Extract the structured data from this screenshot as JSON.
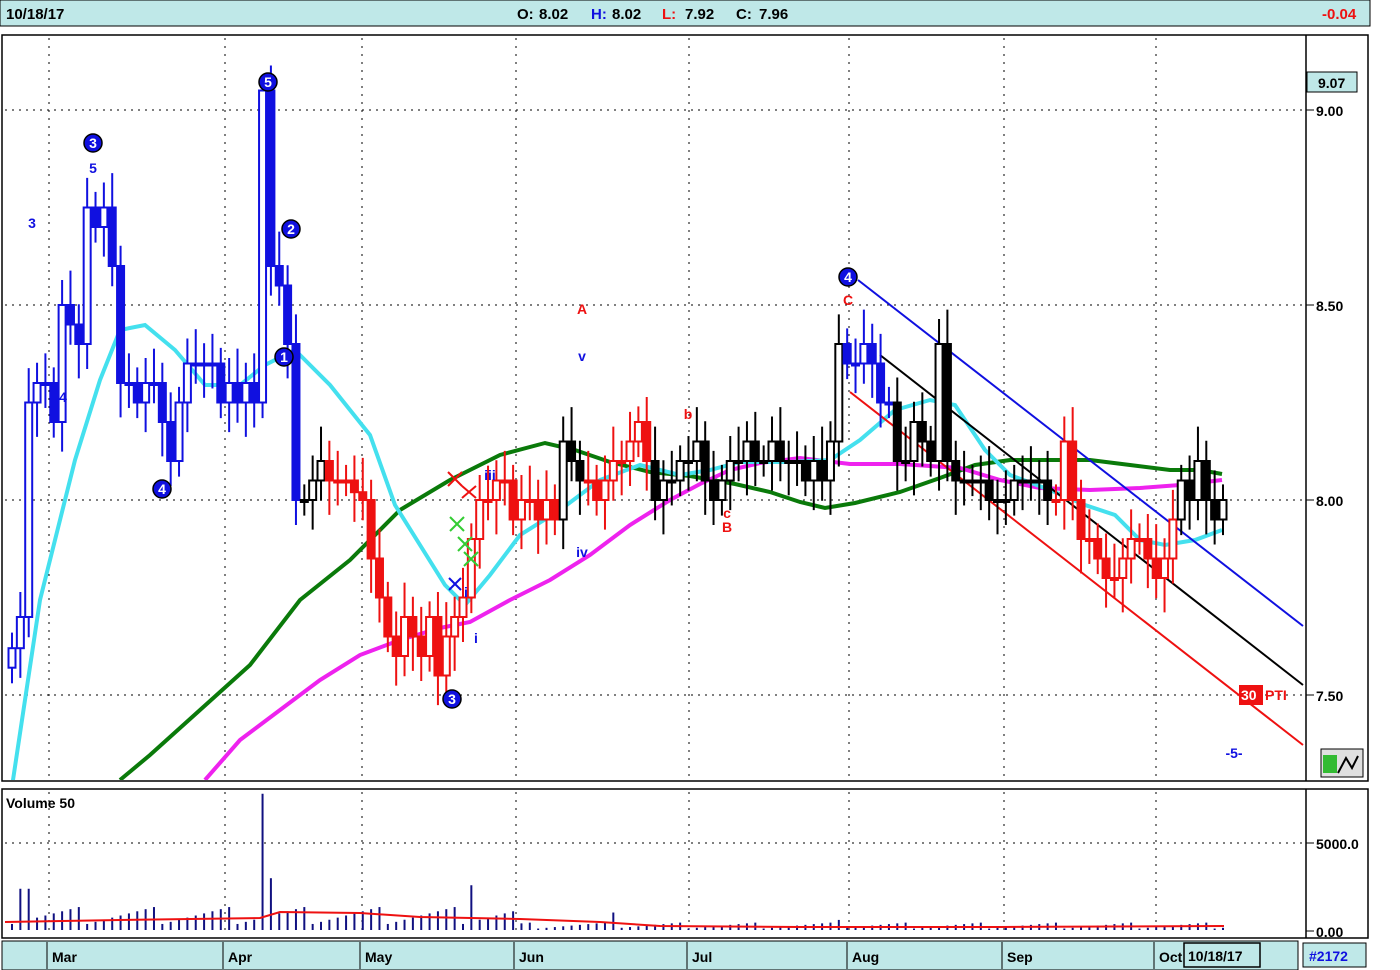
{
  "header": {
    "date": "10/18/17",
    "open_label": "O:",
    "open": "8.02",
    "high_label": "H:",
    "high": "8.02",
    "low_label": "L:",
    "low": "7.92",
    "close_label": "C:",
    "close": "7.96",
    "change": "-0.04"
  },
  "colors": {
    "up_blue": "#1010e0",
    "red": "#ee1111",
    "black": "#000000",
    "cyan": "#44e0ee",
    "green": "#0a7a0a",
    "magenta": "#ee22ee",
    "header_bg": "#bfe8e8",
    "axis_bg": "#bfe8e8",
    "volume_bar": "#101080"
  },
  "price_axis": {
    "ticks": [
      "9.00",
      "8.50",
      "8.00",
      "7.50"
    ],
    "current_label": "9.07",
    "pti_label": "PTI",
    "pti_value": "30"
  },
  "volume_panel": {
    "title": "Volume 50",
    "ticks": [
      "5000.0",
      "0.00"
    ]
  },
  "footer": {
    "months": [
      "Mar",
      "Apr",
      "May",
      "Jun",
      "Jul",
      "Aug",
      "Sep",
      "Oct"
    ],
    "date_box": "10/18/17",
    "symbol_box": "#2172"
  },
  "chart_data": {
    "type": "candlestick",
    "y_range": [
      7.2,
      9.2
    ],
    "y_ticks": [
      9.0,
      8.5,
      8.0,
      7.5
    ],
    "grid": true,
    "x_labels": [
      "Mar",
      "Apr",
      "May",
      "Jun",
      "Jul",
      "Aug",
      "Sep",
      "Oct"
    ],
    "wave_labels": [
      {
        "text": "3",
        "color": "blue",
        "circled": false
      },
      {
        "text": "4",
        "color": "blue",
        "circled": false
      },
      {
        "text": "5",
        "color": "blue",
        "circled": false
      },
      {
        "text": "3",
        "color": "blue",
        "circled": true
      },
      {
        "text": "4",
        "color": "blue",
        "circled": true
      },
      {
        "text": "5",
        "color": "blue",
        "circled": true
      },
      {
        "text": "2",
        "color": "blue",
        "circled": true
      },
      {
        "text": "1",
        "color": "blue",
        "circled": true
      },
      {
        "text": "3",
        "color": "blue",
        "circled": true
      },
      {
        "text": "i",
        "color": "blue",
        "circled": false
      },
      {
        "text": "i",
        "color": "blue",
        "circled": false
      },
      {
        "text": "iii",
        "color": "blue",
        "circled": false
      },
      {
        "text": "v",
        "color": "blue",
        "circled": false
      },
      {
        "text": "iv",
        "color": "blue",
        "circled": false
      },
      {
        "text": "A",
        "color": "red",
        "circled": false
      },
      {
        "text": "b",
        "color": "red",
        "circled": false
      },
      {
        "text": "c",
        "color": "red",
        "circled": false
      },
      {
        "text": "B",
        "color": "red",
        "circled": false
      },
      {
        "text": "C",
        "color": "red",
        "circled": false
      },
      {
        "text": "4",
        "color": "blue",
        "circled": true
      },
      {
        "text": "-5-",
        "color": "blue",
        "circled": false
      }
    ],
    "series": [
      {
        "name": "price",
        "values": [
          7.62,
          7.7,
          8.25,
          8.3,
          8.3,
          8.2,
          8.5,
          8.45,
          8.4,
          8.75,
          8.7,
          8.75,
          8.6,
          8.3,
          8.3,
          8.25,
          8.3,
          8.3,
          8.2,
          8.1,
          8.25,
          8.35,
          8.35,
          8.35,
          8.35,
          8.25,
          8.3,
          8.25,
          8.3,
          8.25,
          9.05,
          8.6,
          8.55,
          8.4,
          8.0,
          8.0,
          8.05,
          8.1,
          8.05,
          8.05,
          8.05,
          8.02,
          8.0,
          7.85,
          7.75,
          7.65,
          7.6,
          7.7,
          7.65,
          7.6,
          7.7,
          7.55,
          7.65,
          7.7,
          7.75,
          7.9,
          8.0,
          8.0,
          8.05,
          8.05,
          7.95,
          8.0,
          8.0,
          7.95,
          8.0,
          7.95,
          8.15,
          8.1,
          8.05,
          8.05,
          8.0,
          8.05,
          8.1,
          8.1,
          8.15,
          8.2,
          8.1,
          8.0,
          8.05,
          8.05,
          8.1,
          8.1,
          8.15,
          8.05,
          8.0,
          8.05,
          8.1,
          8.1,
          8.15,
          8.1,
          8.1,
          8.15,
          8.1,
          8.1,
          8.1,
          8.05,
          8.1,
          8.05,
          8.15,
          8.4,
          8.35,
          8.35,
          8.4,
          8.35,
          8.25,
          8.25,
          8.1,
          8.1,
          8.2,
          8.15,
          8.1,
          8.4,
          8.1,
          8.05,
          8.05,
          8.05,
          8.05,
          8.0,
          8.0,
          8.0,
          8.05,
          8.05,
          8.05,
          8.05,
          8.0,
          8.0,
          8.15,
          8.0,
          7.9,
          7.9,
          7.85,
          7.8,
          7.8,
          7.85,
          7.9,
          7.9,
          7.85,
          7.8,
          7.85,
          7.95,
          8.05,
          8.0,
          8.1,
          8.0,
          7.95,
          8.0
        ]
      },
      {
        "name": "avg_cyan",
        "values": []
      },
      {
        "name": "avg_green",
        "values": []
      },
      {
        "name": "avg_magenta",
        "values": []
      }
    ],
    "volume_max_label": 5000
  }
}
